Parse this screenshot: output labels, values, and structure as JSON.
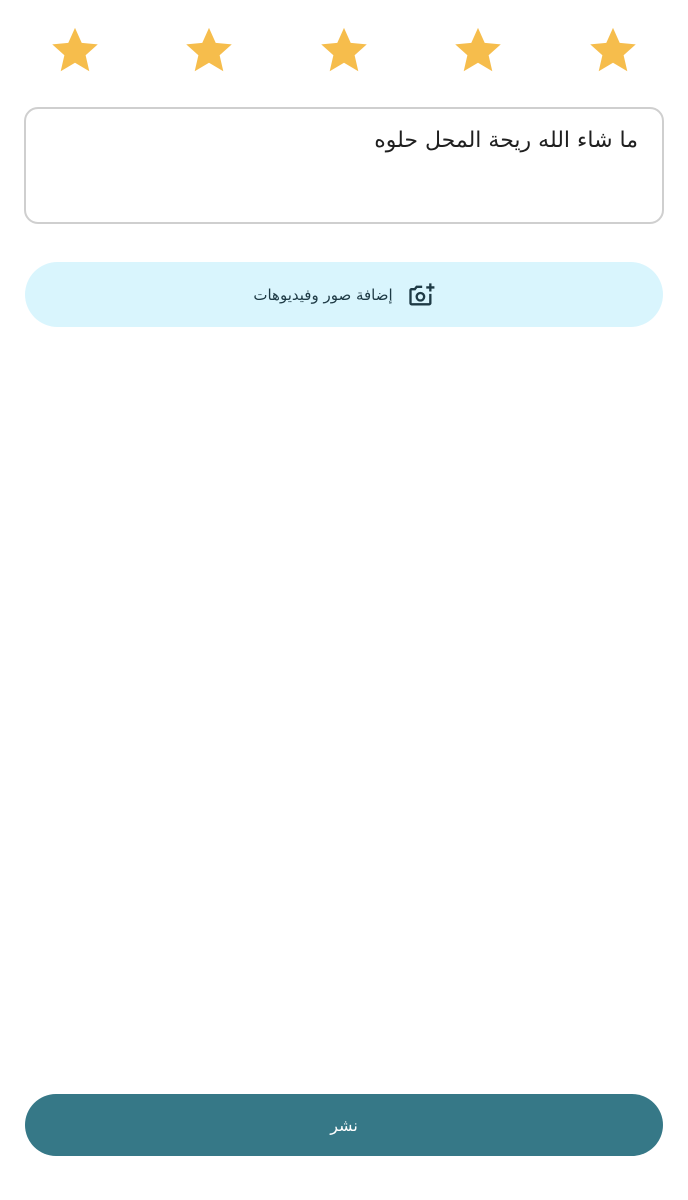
{
  "rating": {
    "value": 5,
    "max": 5,
    "star_color": "#f6bd4c",
    "icon": "star-icon"
  },
  "review": {
    "text": "ما شاء الله ريحة المحل حلوه"
  },
  "add_media": {
    "label": "إضافة صور وفيديوهات",
    "icon": "add-photo-camera-icon",
    "background": "#d9f5fd"
  },
  "publish": {
    "label": "نشر",
    "background": "#367887"
  }
}
